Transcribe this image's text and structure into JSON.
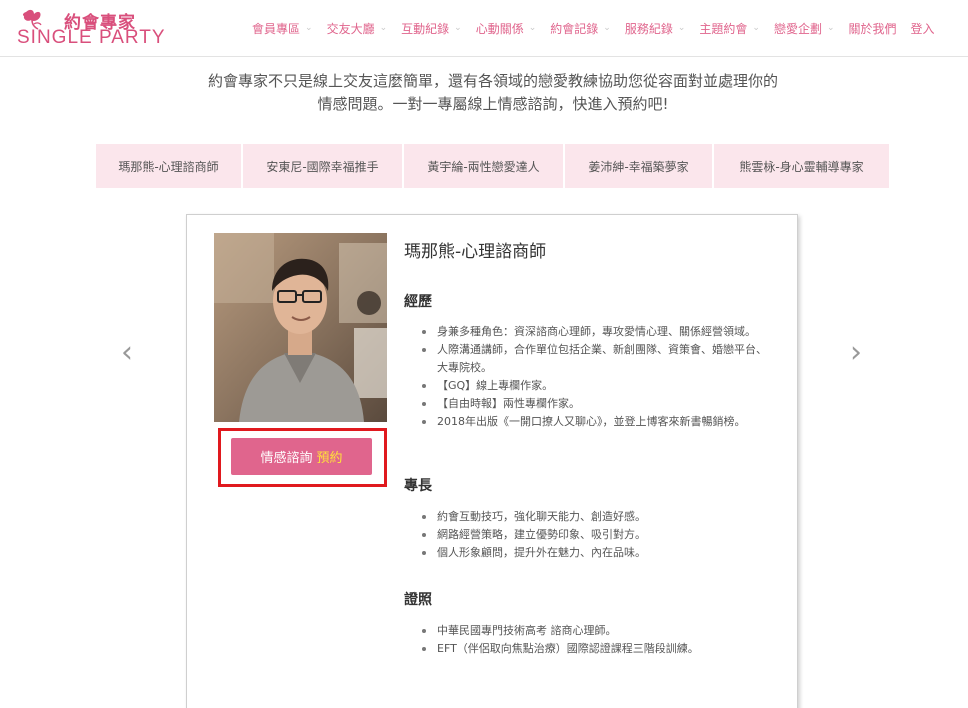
{
  "brand": {
    "name_zh": "約會專家",
    "name_en": "SINGLE PARTY",
    "accent": "#e0658d"
  },
  "nav": {
    "items": [
      {
        "label": "會員專區",
        "dropdown": true
      },
      {
        "label": "交友大廳",
        "dropdown": true
      },
      {
        "label": "互動紀錄",
        "dropdown": true
      },
      {
        "label": "心動關係",
        "dropdown": true
      },
      {
        "label": "約會記錄",
        "dropdown": true
      },
      {
        "label": "服務紀錄",
        "dropdown": true
      },
      {
        "label": "主題約會",
        "dropdown": true
      },
      {
        "label": "戀愛企劃",
        "dropdown": true
      },
      {
        "label": "關於我們",
        "dropdown": false
      },
      {
        "label": "登入",
        "dropdown": false
      }
    ],
    "chevron": "⌄"
  },
  "intro": {
    "line1": "約會專家不只是線上交友這麼簡單，還有各領域的戀愛教練協助您從容面對並處理你的",
    "line2": "情感問題。一對一專屬線上情感諮詢，快進入預約吧!"
  },
  "tabs": [
    "瑪那熊-心理諮商師",
    "安東尼-國際幸福推手",
    "黃宇綸-兩性戀愛達人",
    "姜沛紳-幸福築夢家",
    "熊雲栐-身心靈輔導專家"
  ],
  "carousel": {
    "prev_icon": "chevron-left-icon",
    "next_icon": "chevron-right-icon",
    "prev_glyph": "‹",
    "next_glyph": "›"
  },
  "profile": {
    "name": "瑪那熊-心理諮商師",
    "button_label": "情感諮詢",
    "button_highlight": "預約",
    "highlight_color": "#ffe23a",
    "sections": [
      {
        "title": "經歷",
        "items": [
          "身兼多種角色：資深諮商心理師，專攻愛情心理、關係經營領域。",
          "人際溝通講師，合作單位包括企業、新創團隊、資策會、婚戀平台、大專院校。",
          "【GQ】線上專欄作家。",
          "【自由時報】兩性專欄作家。",
          "2018年出版《一開口撩人又聊心》，並登上博客來新書暢銷榜。"
        ]
      },
      {
        "title": "專長",
        "items": [
          "約會互動技巧，強化聊天能力、創造好感。",
          "網路經營策略，建立優勢印象、吸引對方。",
          "個人形象顧問，提升外在魅力、內在品味。"
        ]
      },
      {
        "title": "證照",
        "items": [
          "中華民國專門技術高考  諮商心理師。",
          "EFT（伴侶取向焦點治療）國際認證課程三階段訓練。"
        ]
      }
    ]
  }
}
